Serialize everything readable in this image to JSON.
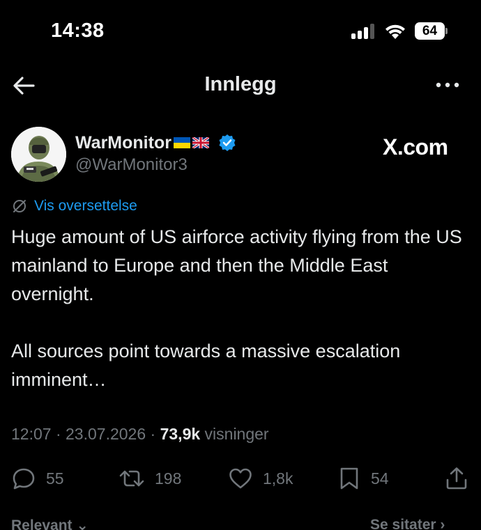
{
  "status_bar": {
    "time": "14:38",
    "battery": "64"
  },
  "header": {
    "title": "Innlegg",
    "back_icon": "arrow-left-icon",
    "more_icon": "more-horizontal-icon"
  },
  "post": {
    "author": {
      "name": "WarMonitor",
      "flags": [
        "ukraine-flag",
        "uk-flag"
      ],
      "verified": true,
      "handle": "@WarMonitor3"
    },
    "source_badge": "X.com",
    "translate_label": "Vis oversettelse",
    "text_paragraphs": [
      "Huge amount of US airforce activity flying from the US mainland to Europe and then the Middle East overnight.",
      "All sources point towards a massive escalation imminent…"
    ],
    "meta": {
      "time": "12:07",
      "separator": "·",
      "date": "23.07.2026",
      "views_count": "73,9k",
      "views_label": "visninger"
    },
    "actions": {
      "replies": "55",
      "reposts": "198",
      "likes": "1,8k",
      "bookmarks": "54"
    }
  },
  "replies_bar": {
    "sort_label": "Relevant",
    "quotes_label": "Se sitater"
  },
  "colors": {
    "background": "#000000",
    "text": "#e7e9ea",
    "muted": "#71767b",
    "link": "#1d9bf0",
    "verified": "#1d9bf0"
  }
}
